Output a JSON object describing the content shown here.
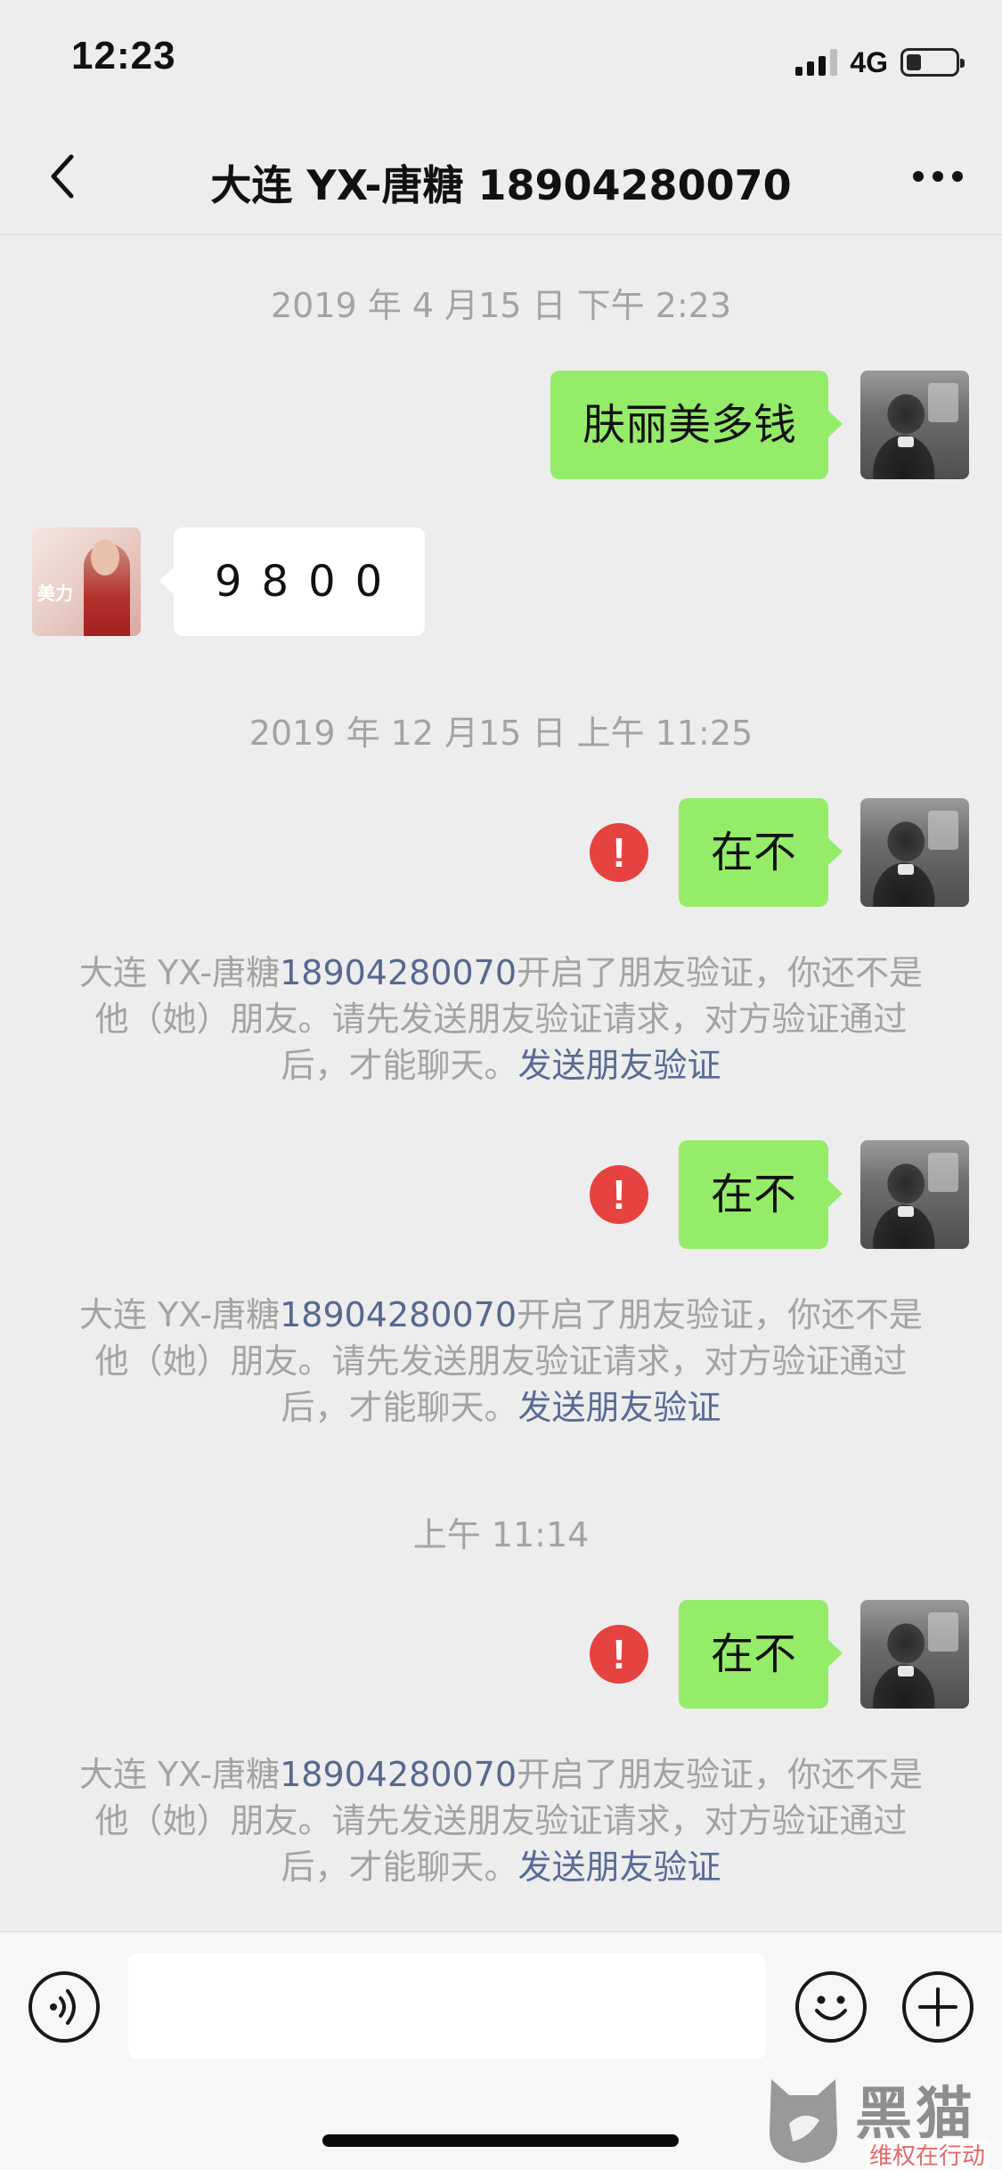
{
  "status_bar": {
    "time": "12:23",
    "network": "4G",
    "signal_icon": "signal-bars-icon",
    "battery_icon": "battery-icon"
  },
  "nav": {
    "title": "大连 YX-唐糖 18904280070",
    "back_icon": "chevron-left-icon",
    "more_icon": "more-dots-icon"
  },
  "messages": {
    "ts1": "2019 年 4 月15 日 下午 2:23",
    "m1": "肤丽美多钱",
    "m2": "9800",
    "ts2": "2019 年 12 月15 日 上午 11:25",
    "m3": "在不",
    "ts3": "上午 11:14",
    "m4": "在不",
    "m5": "在不"
  },
  "system_notice": {
    "prefix": "大连 YX-唐糖",
    "number": "18904280070",
    "body": "开启了朋友验证，你还不是他（她）朋友。请先发送朋友验证请求，对方验证通过后，才能聊天。",
    "link": "发送朋友验证"
  },
  "failed_icon": "!",
  "input_bar": {
    "voice_icon": "voice-icon",
    "emoji_icon": "emoji-icon",
    "plus_icon": "plus-icon",
    "input_value": ""
  },
  "watermark": {
    "brand": "黑猫",
    "tag": "维权在行动"
  },
  "colors": {
    "bg": "#ededed",
    "bubble_mine": "#95ec69",
    "bubble_theirs": "#ffffff",
    "link": "#576b95",
    "error": "#e64340"
  }
}
